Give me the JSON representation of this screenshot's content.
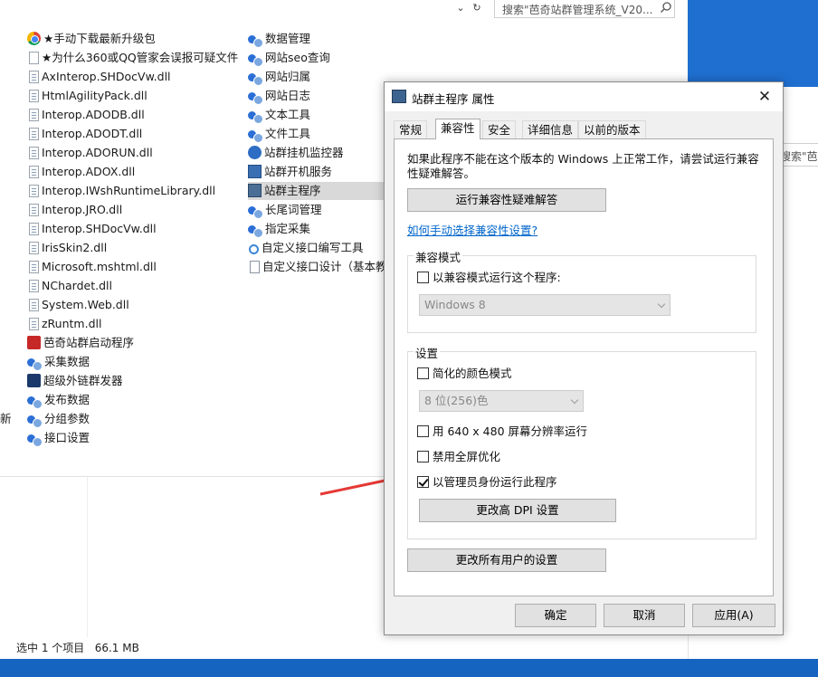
{
  "explorer": {
    "search_placeholder": "搜索\"芭奇站群管理系统_V20...",
    "status": {
      "selection": "选中 1 个项目",
      "size": "66.1 MB"
    },
    "left_edge_text": "新",
    "files_col1": [
      {
        "name": "★手动下载最新升级包",
        "icon": "chrome-icon"
      },
      {
        "name": "★为什么360或QQ管家会误报可疑文件",
        "icon": "text-file-icon"
      },
      {
        "name": "AxInterop.SHDocVw.dll",
        "icon": "dll-icon"
      },
      {
        "name": "HtmlAgilityPack.dll",
        "icon": "dll-icon"
      },
      {
        "name": "Interop.ADODB.dll",
        "icon": "dll-icon"
      },
      {
        "name": "Interop.ADODT.dll",
        "icon": "dll-icon"
      },
      {
        "name": "Interop.ADORUN.dll",
        "icon": "dll-icon"
      },
      {
        "name": "Interop.ADOX.dll",
        "icon": "dll-icon"
      },
      {
        "name": "Interop.IWshRuntimeLibrary.dll",
        "icon": "dll-icon"
      },
      {
        "name": "Interop.JRO.dll",
        "icon": "dll-icon"
      },
      {
        "name": "Interop.SHDocVw.dll",
        "icon": "dll-icon"
      },
      {
        "name": "IrisSkin2.dll",
        "icon": "dll-icon"
      },
      {
        "name": "Microsoft.mshtml.dll",
        "icon": "dll-icon"
      },
      {
        "name": "NChardet.dll",
        "icon": "dll-icon"
      },
      {
        "name": "System.Web.dll",
        "icon": "dll-icon"
      },
      {
        "name": "zRuntm.dll",
        "icon": "dll-icon"
      },
      {
        "name": "芭奇站群启动程序",
        "icon": "launcher-icon"
      },
      {
        "name": "采集数据",
        "icon": "app-icon"
      },
      {
        "name": "超级外链群发器",
        "icon": "arrow-app-icon"
      },
      {
        "name": "发布数据",
        "icon": "app-icon"
      },
      {
        "name": "分组参数",
        "icon": "app-icon"
      },
      {
        "name": "接口设置",
        "icon": "app-icon"
      }
    ],
    "files_col2": [
      {
        "name": "数据管理",
        "icon": "app-icon"
      },
      {
        "name": "网站seo查询",
        "icon": "app-icon"
      },
      {
        "name": "网站归属",
        "icon": "app-icon"
      },
      {
        "name": "网站日志",
        "icon": "app-icon"
      },
      {
        "name": "文本工具",
        "icon": "app-icon"
      },
      {
        "name": "文件工具",
        "icon": "app-icon"
      },
      {
        "name": "站群挂机监控器",
        "icon": "globe-icon"
      },
      {
        "name": "站群开机服务",
        "icon": "service-icon"
      },
      {
        "name": "站群主程序",
        "icon": "window-app-icon",
        "selected": true
      },
      {
        "name": "长尾词管理",
        "icon": "app-icon"
      },
      {
        "name": "指定采集",
        "icon": "app-icon"
      },
      {
        "name": "自定义接口编写工具",
        "icon": "search-app-icon"
      },
      {
        "name": "自定义接口设计（基本教",
        "icon": "document-icon"
      }
    ]
  },
  "second_window": {
    "search_text": "搜索\"芭奇"
  },
  "dialog": {
    "title": "站群主程序 属性",
    "tabs": [
      {
        "label": "常规",
        "active": false
      },
      {
        "label": "兼容性",
        "active": true
      },
      {
        "label": "安全",
        "active": false
      },
      {
        "label": "详细信息",
        "active": false
      },
      {
        "label": "以前的版本",
        "active": false
      }
    ],
    "intro_text": "如果此程序不能在这个版本的 Windows 上正常工作，请尝试运行兼容性疑难解答。",
    "troubleshooter_button": "运行兼容性疑难解答",
    "manual_link": "如何手动选择兼容性设置?",
    "compat_mode": {
      "group_label": "兼容模式",
      "checkbox_label": "以兼容模式运行这个程序:",
      "checked": false,
      "os_select_value": "Windows 8"
    },
    "settings": {
      "group_label": "设置",
      "reduced_color_label": "简化的颜色模式",
      "reduced_color_checked": false,
      "color_select_value": "8 位(256)色",
      "res_640_label": "用 640 x 480 屏幕分辨率运行",
      "res_640_checked": false,
      "disable_fullscreen_label": "禁用全屏优化",
      "disable_fullscreen_checked": false,
      "run_as_admin_label": "以管理员身份运行此程序",
      "run_as_admin_checked": true,
      "dpi_button": "更改高 DPI 设置"
    },
    "all_users_button": "更改所有用户的设置",
    "ok_button": "确定",
    "cancel_button": "取消",
    "apply_button": "应用(A)"
  },
  "colors": {
    "selection": "#d9d9d9",
    "link": "#0066cc",
    "annotation_arrow": "#e53935",
    "desktop_blue": "#1f6fd0"
  }
}
